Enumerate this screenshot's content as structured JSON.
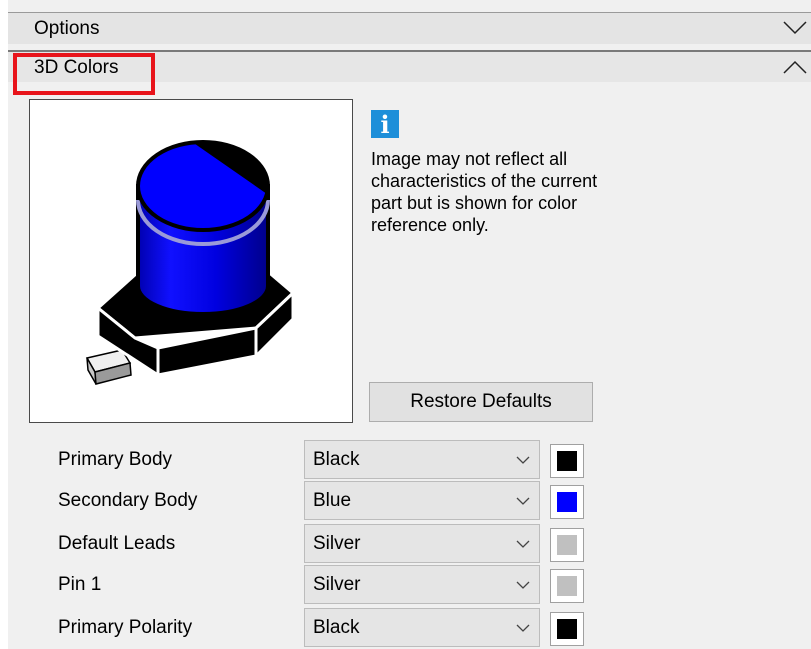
{
  "options_section": {
    "title": "Options"
  },
  "colors_section": {
    "title": "3D Colors"
  },
  "info": {
    "icon": "info-icon",
    "message": "Image may not reflect all characteristics of the current part but is shown for color reference only."
  },
  "restore_button": {
    "label": "Restore Defaults"
  },
  "color_rows": [
    {
      "label": "Primary Body",
      "value": "Black",
      "swatch": "#000000"
    },
    {
      "label": "Secondary Body",
      "value": "Blue",
      "swatch": "#0000ff"
    },
    {
      "label": "Default Leads",
      "value": "Silver",
      "swatch": "#c0c0c0"
    },
    {
      "label": "Pin 1",
      "value": "Silver",
      "swatch": "#c0c0c0"
    },
    {
      "label": "Primary Polarity",
      "value": "Black",
      "swatch": "#000000"
    }
  ]
}
